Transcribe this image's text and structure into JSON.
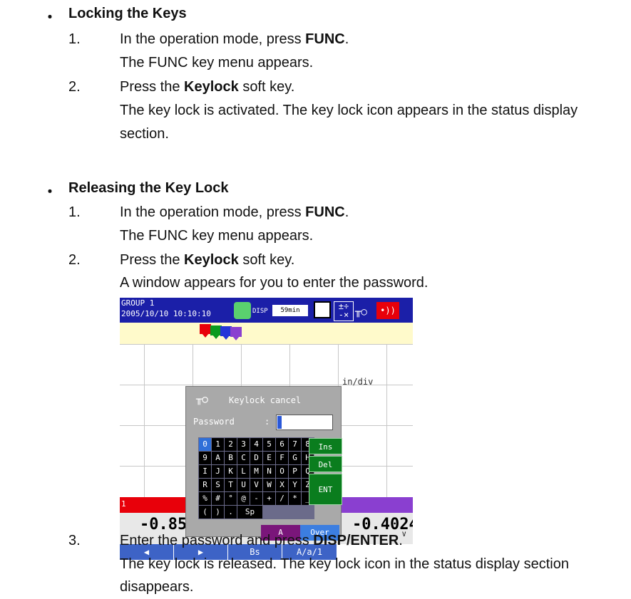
{
  "section1": {
    "bullet": "・",
    "title": "Locking the Keys",
    "steps": [
      {
        "num": "1.",
        "pre": "In the operation mode, press ",
        "bold": "FUNC",
        "post": ".",
        "result": [
          "The FUNC key menu appears."
        ]
      },
      {
        "num": "2.",
        "pre": "Press the ",
        "bold": "Keylock",
        "post": " soft key.",
        "result": [
          "The key lock is activated.  The key lock icon appears in the status display",
          "section."
        ]
      }
    ]
  },
  "section2": {
    "bullet": "・",
    "title": "Releasing the Key Lock",
    "steps": [
      {
        "num": "1.",
        "pre": "In the operation mode, press ",
        "bold": "FUNC",
        "post": ".",
        "result": [
          "The FUNC key menu appears."
        ]
      },
      {
        "num": "2.",
        "pre": "Press the ",
        "bold": "Keylock",
        "post": " soft key.",
        "result": [
          "A window appears for you to enter the password."
        ]
      },
      {
        "num": "3.",
        "pre": "Enter the password and press ",
        "bold": "DISP/ENTER",
        "post": ".",
        "result": [
          "The key lock is released.  The key lock icon in the status display section",
          "disappears."
        ]
      }
    ]
  },
  "screen": {
    "group": "GROUP 1",
    "datetime": "2005/10/10 10:10:10",
    "disp": "DISP",
    "rate": "59min",
    "markers": [
      "1",
      "2",
      "3",
      "4"
    ],
    "scale": "in/div",
    "dialog_title": "Keylock cancel",
    "password_label": "Password",
    "password_colon": ":",
    "keys": [
      "0",
      "1",
      "2",
      "3",
      "4",
      "5",
      "6",
      "7",
      "8",
      "9",
      "A",
      "B",
      "C",
      "D",
      "E",
      "F",
      "G",
      "H",
      "I",
      "J",
      "K",
      "L",
      "M",
      "N",
      "O",
      "P",
      "Q",
      "R",
      "S",
      "T",
      "U",
      "V",
      "W",
      "X",
      "Y",
      "Z",
      "%",
      "#",
      "°",
      "@",
      "-",
      "+",
      "/",
      "*",
      "_",
      "(",
      ")",
      ".",
      "Sp"
    ],
    "side_keys": [
      "Ins",
      "Del",
      "ENT"
    ],
    "mode_a": "A",
    "mode_over": "Over",
    "value_left": "-0.853",
    "value_right": "-0.4024",
    "unit_right": "V",
    "channel_left": "1",
    "bottom_keys": [
      "◀",
      "▶",
      "Bs",
      "A/a/1"
    ],
    "colors": {
      "header": "#1b1fa8",
      "band": "#fffacb",
      "red": "#e8000a",
      "purple": "#8a3fd0",
      "green": "#0a7d1e"
    }
  }
}
